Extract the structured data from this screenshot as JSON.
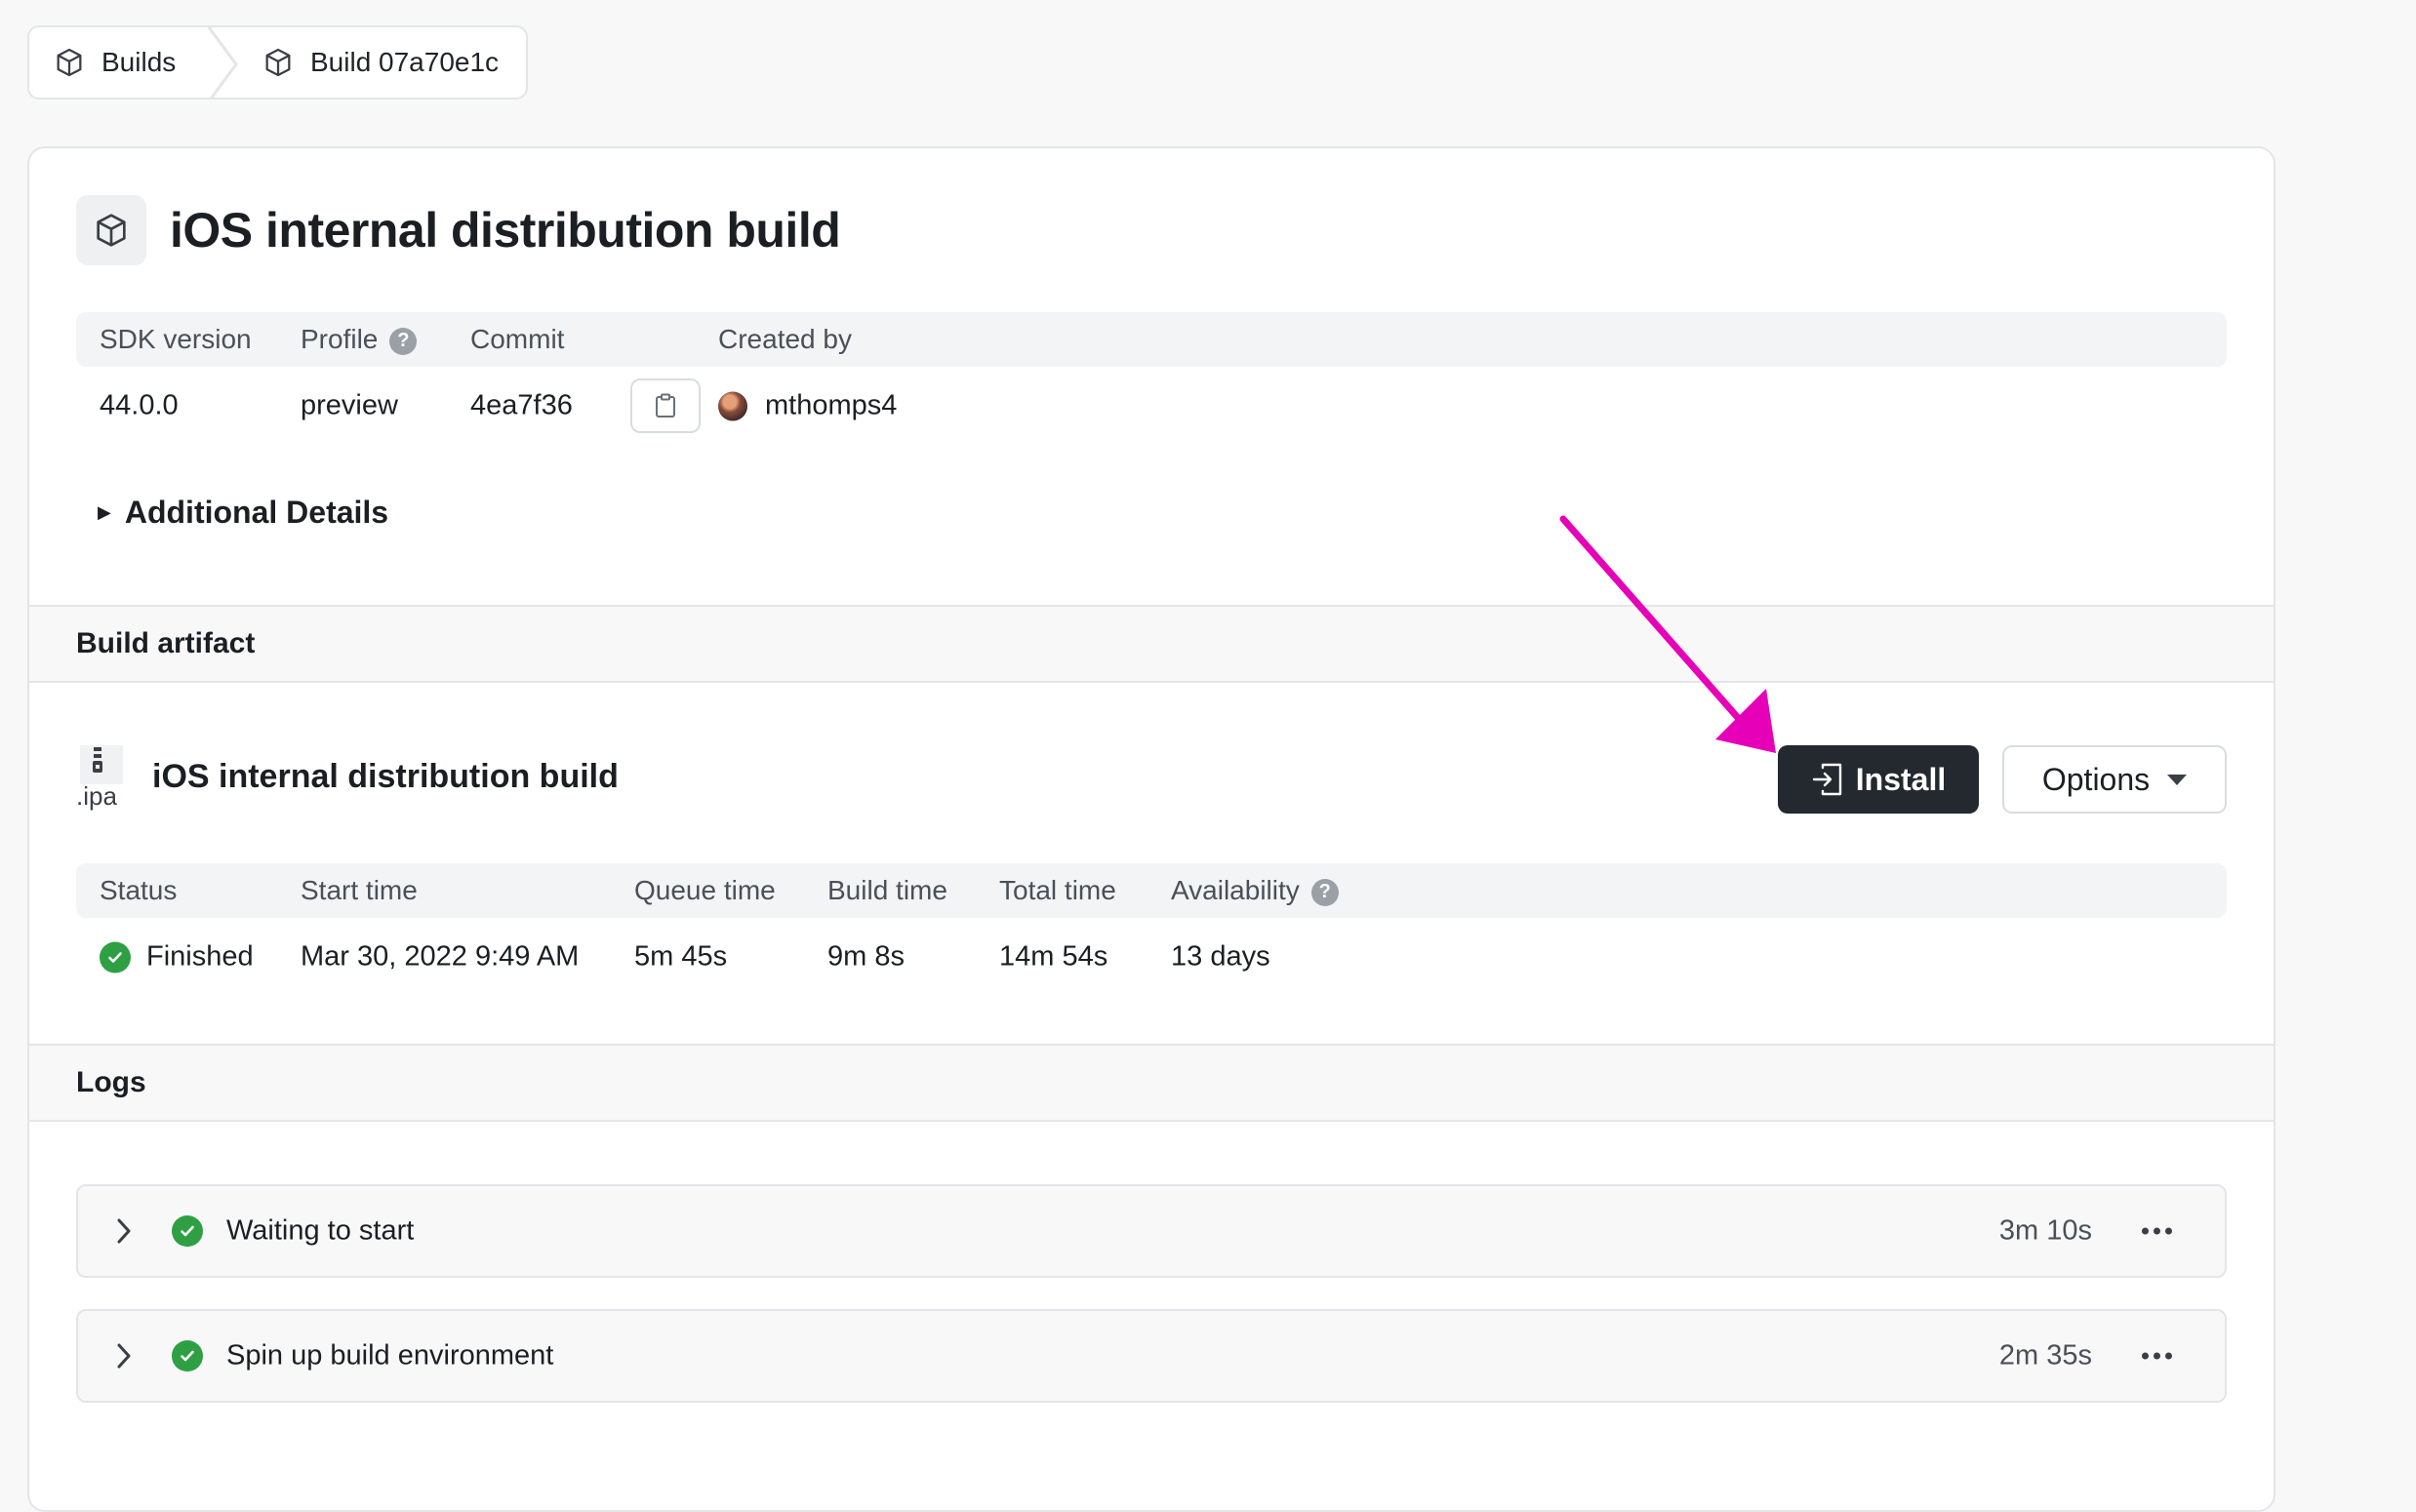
{
  "breadcrumb": {
    "items": [
      {
        "label": "Builds",
        "icon": "cube-icon"
      },
      {
        "label": "Build 07a70e1c",
        "icon": "cube-icon"
      }
    ]
  },
  "header": {
    "title": "iOS internal distribution build",
    "icon": "cube-icon"
  },
  "build_info": {
    "columns": {
      "sdk": "SDK version",
      "profile": "Profile",
      "commit": "Commit",
      "created_by": "Created by"
    },
    "values": {
      "sdk": "44.0.0",
      "profile": "preview",
      "commit": "4ea7f36",
      "created_by": "mthomps4"
    }
  },
  "additional_details": {
    "label": "Additional Details"
  },
  "artifact": {
    "section_title": "Build artifact",
    "icon_label": ".ipa",
    "name": "iOS internal distribution build",
    "install_label": "Install",
    "options_label": "Options",
    "columns": {
      "status": "Status",
      "start": "Start time",
      "queue": "Queue time",
      "build": "Build time",
      "total": "Total time",
      "availability": "Availability"
    },
    "values": {
      "status": "Finished",
      "start": "Mar 30, 2022 9:49 AM",
      "queue": "5m 45s",
      "build": "9m 8s",
      "total": "14m 54s",
      "availability": "13 days"
    }
  },
  "logs": {
    "section_title": "Logs",
    "items": [
      {
        "title": "Waiting to start",
        "duration": "3m 10s"
      },
      {
        "title": "Spin up build environment",
        "duration": "2m 35s"
      }
    ]
  },
  "colors": {
    "accent_arrow": "#e600b8",
    "success": "#2ea043",
    "install_bg": "#24292f"
  }
}
